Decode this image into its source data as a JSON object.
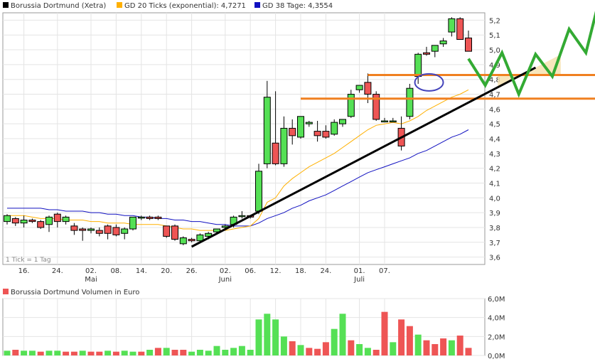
{
  "legend": [
    {
      "label": "Borussia Dortmund (Xetra)",
      "color": "#000000",
      "icon": "square-swatch"
    },
    {
      "label": "GD 20 Ticks (exponential): 4,7271",
      "color": "#ffb000",
      "icon": "square-swatch"
    },
    {
      "label": "GD 38 Tage: 4,3554",
      "color": "#1010c0",
      "icon": "square-swatch"
    }
  ],
  "tick_note": "1 Tick = 1 Tag",
  "volume_title": "Borussia Dortmund Volumen in Euro",
  "colors": {
    "up": "#55e055",
    "down": "#ee5555",
    "ma20": "#ffb000",
    "ma38": "#1010c0",
    "trend": "#000000",
    "resistance": "#f08020",
    "projection": "#33aa33",
    "circle": "#4444bb"
  },
  "chart_data": {
    "type": "candlestick",
    "price_axis": {
      "ticks": [
        "3,6",
        "3,7",
        "3,8",
        "3,9",
        "4,0",
        "4,1",
        "4,2",
        "4,3",
        "4,4",
        "4,5",
        "4,6",
        "4,7",
        "4,8",
        "4,9",
        "5,0",
        "5,1",
        "5,2"
      ],
      "range": [
        3.55,
        5.25
      ]
    },
    "volume_axis": {
      "ticks": [
        "0,0M",
        "2,0M",
        "4,0M",
        "6,0M"
      ],
      "range": [
        0,
        6.0
      ]
    },
    "x_ticks": [
      "16.",
      "24.",
      "02.",
      "08.",
      "14.",
      "20.",
      "26.",
      "02.",
      "06.",
      "12.",
      "18.",
      "24.",
      "01.",
      "07."
    ],
    "x_tick_idx": [
      2,
      6,
      10,
      13,
      16,
      19,
      22,
      26,
      29,
      32,
      35,
      38,
      42,
      45
    ],
    "month_labels": [
      "Mai",
      "Juni",
      "Juli"
    ],
    "month_idx": [
      10,
      26,
      42
    ],
    "candles": [
      [
        3.84,
        3.89,
        3.82,
        3.88
      ],
      [
        3.86,
        3.87,
        3.81,
        3.83
      ],
      [
        3.83,
        3.88,
        3.8,
        3.85
      ],
      [
        3.85,
        3.86,
        3.83,
        3.84
      ],
      [
        3.84,
        3.85,
        3.79,
        3.8
      ],
      [
        3.82,
        3.88,
        3.77,
        3.87
      ],
      [
        3.89,
        3.9,
        3.8,
        3.84
      ],
      [
        3.84,
        3.88,
        3.82,
        3.87
      ],
      [
        3.81,
        3.83,
        3.75,
        3.78
      ],
      [
        3.79,
        3.8,
        3.71,
        3.78
      ],
      [
        3.78,
        3.8,
        3.76,
        3.79
      ],
      [
        3.78,
        3.8,
        3.74,
        3.76
      ],
      [
        3.81,
        3.82,
        3.72,
        3.76
      ],
      [
        3.8,
        3.82,
        3.74,
        3.75
      ],
      [
        3.76,
        3.8,
        3.72,
        3.79
      ],
      [
        3.79,
        3.87,
        3.78,
        3.87
      ],
      [
        3.87,
        3.88,
        3.85,
        3.87
      ],
      [
        3.87,
        3.88,
        3.85,
        3.86
      ],
      [
        3.87,
        3.88,
        3.85,
        3.86
      ],
      [
        3.81,
        3.81,
        3.73,
        3.74
      ],
      [
        3.81,
        3.82,
        3.71,
        3.72
      ],
      [
        3.69,
        3.74,
        3.68,
        3.73
      ],
      [
        3.72,
        3.73,
        3.7,
        3.71
      ],
      [
        3.71,
        3.76,
        3.7,
        3.75
      ],
      [
        3.74,
        3.77,
        3.72,
        3.76
      ],
      [
        3.77,
        3.79,
        3.76,
        3.79
      ],
      [
        3.8,
        3.82,
        3.78,
        3.81
      ],
      [
        3.82,
        3.88,
        3.8,
        3.87
      ],
      [
        3.88,
        3.91,
        3.86,
        3.88
      ],
      [
        3.88,
        3.88,
        3.86,
        3.87
      ],
      [
        3.91,
        4.23,
        3.89,
        4.18
      ],
      [
        4.23,
        4.79,
        4.2,
        4.68
      ],
      [
        4.37,
        4.72,
        4.22,
        4.23
      ],
      [
        4.23,
        4.55,
        4.21,
        4.47
      ],
      [
        4.47,
        4.53,
        4.36,
        4.42
      ],
      [
        4.41,
        4.55,
        4.4,
        4.55
      ],
      [
        4.5,
        4.52,
        4.48,
        4.51
      ],
      [
        4.45,
        4.52,
        4.38,
        4.42
      ],
      [
        4.45,
        4.49,
        4.4,
        4.41
      ],
      [
        4.43,
        4.53,
        4.42,
        4.51
      ],
      [
        4.5,
        4.53,
        4.48,
        4.53
      ],
      [
        4.55,
        4.73,
        4.54,
        4.7
      ],
      [
        4.73,
        4.75,
        4.71,
        4.76
      ],
      [
        4.78,
        4.84,
        4.64,
        4.7
      ],
      [
        4.7,
        4.72,
        4.52,
        4.53
      ],
      [
        4.52,
        4.54,
        4.51,
        4.52
      ],
      [
        4.52,
        4.54,
        4.51,
        4.52
      ],
      [
        4.47,
        4.55,
        4.32,
        4.35
      ],
      [
        4.55,
        4.77,
        4.53,
        4.74
      ],
      [
        4.82,
        4.98,
        4.77,
        4.97
      ],
      [
        4.98,
        5.02,
        4.96,
        4.97
      ],
      [
        4.99,
        5.03,
        4.95,
        5.03
      ],
      [
        5.04,
        5.08,
        5.02,
        5.06
      ],
      [
        5.12,
        5.22,
        5.09,
        5.21
      ],
      [
        5.21,
        5.22,
        5.08,
        5.07
      ],
      [
        5.08,
        5.13,
        4.99,
        4.99
      ]
    ],
    "ma20": [
      3.88,
      3.88,
      3.88,
      3.87,
      3.86,
      3.86,
      3.86,
      3.85,
      3.85,
      3.85,
      3.84,
      3.84,
      3.83,
      3.83,
      3.83,
      3.82,
      3.82,
      3.82,
      3.82,
      3.81,
      3.8,
      3.79,
      3.79,
      3.78,
      3.78,
      3.78,
      3.78,
      3.79,
      3.8,
      3.81,
      3.86,
      3.97,
      4.0,
      4.08,
      4.13,
      4.17,
      4.21,
      4.24,
      4.27,
      4.3,
      4.34,
      4.38,
      4.42,
      4.46,
      4.49,
      4.5,
      4.51,
      4.5,
      4.52,
      4.55,
      4.59,
      4.62,
      4.65,
      4.68,
      4.7,
      4.73
    ],
    "ma38": [
      3.93,
      3.93,
      3.93,
      3.93,
      3.93,
      3.92,
      3.92,
      3.91,
      3.91,
      3.91,
      3.9,
      3.9,
      3.89,
      3.89,
      3.88,
      3.88,
      3.87,
      3.87,
      3.86,
      3.86,
      3.85,
      3.85,
      3.84,
      3.84,
      3.83,
      3.82,
      3.82,
      3.81,
      3.81,
      3.81,
      3.83,
      3.86,
      3.88,
      3.9,
      3.93,
      3.95,
      3.98,
      4.0,
      4.02,
      4.05,
      4.08,
      4.11,
      4.14,
      4.17,
      4.19,
      4.21,
      4.23,
      4.25,
      4.27,
      4.3,
      4.32,
      4.35,
      4.38,
      4.41,
      4.43,
      4.46
    ],
    "volume": [
      0.5,
      0.6,
      0.5,
      0.5,
      0.4,
      0.5,
      0.5,
      0.4,
      0.4,
      0.5,
      0.4,
      0.4,
      0.5,
      0.4,
      0.5,
      0.4,
      0.4,
      0.6,
      0.8,
      0.8,
      0.6,
      0.6,
      0.4,
      0.6,
      0.5,
      1.0,
      0.6,
      0.8,
      1.0,
      0.6,
      3.8,
      4.4,
      3.8,
      2.0,
      1.5,
      1.1,
      0.8,
      0.7,
      1.4,
      2.8,
      4.4,
      1.6,
      1.2,
      0.8,
      0.6,
      4.6,
      1.4,
      3.8,
      3.1,
      2.2,
      1.6,
      1.2,
      1.8,
      1.6,
      2.1,
      0.8
    ],
    "volume_colors": [
      "g",
      "r",
      "g",
      "g",
      "r",
      "g",
      "g",
      "r",
      "r",
      "g",
      "r",
      "r",
      "g",
      "r",
      "g",
      "g",
      "r",
      "g",
      "r",
      "g",
      "r",
      "r",
      "g",
      "g",
      "g",
      "g",
      "g",
      "g",
      "g",
      "g",
      "g",
      "g",
      "g",
      "g",
      "r",
      "g",
      "r",
      "r",
      "r",
      "g",
      "g",
      "r",
      "g",
      "g",
      "r",
      "r",
      "g",
      "r",
      "r",
      "g",
      "r",
      "r",
      "r",
      "g",
      "r",
      "r"
    ],
    "trend_line": {
      "from": {
        "i": 22,
        "v": 3.67
      },
      "to": {
        "i": 63,
        "v": 4.88
      }
    },
    "resistance_levels": [
      4.83,
      4.67
    ],
    "projection_zigzag": [
      [
        55,
        4.94
      ],
      [
        57,
        4.76
      ],
      [
        59,
        4.98
      ],
      [
        61,
        4.7
      ],
      [
        63,
        4.97
      ],
      [
        65,
        4.82
      ],
      [
        67,
        5.14
      ],
      [
        69,
        4.98
      ],
      [
        71,
        5.43
      ]
    ]
  }
}
